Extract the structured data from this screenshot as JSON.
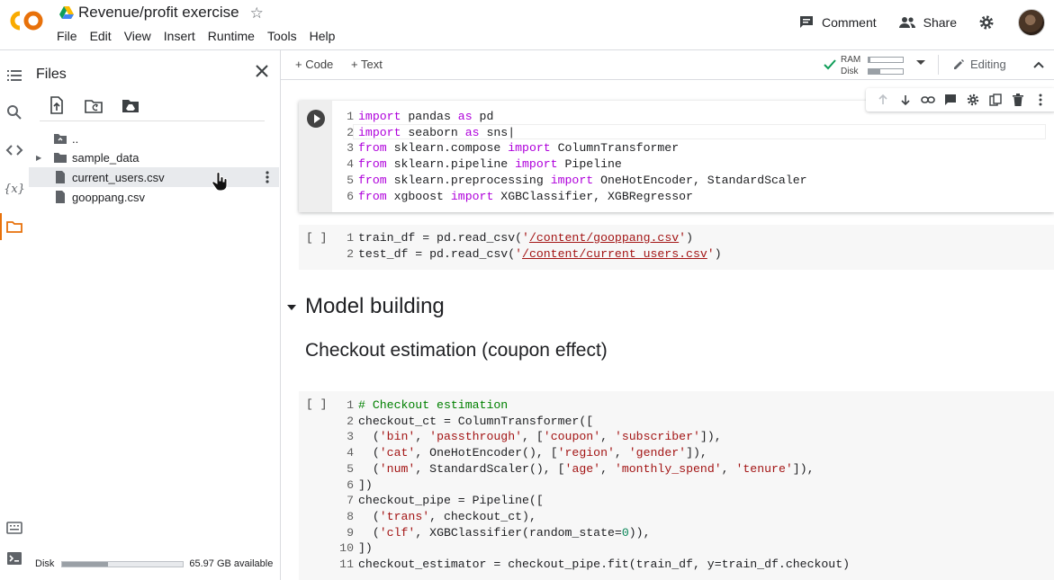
{
  "header": {
    "doc_title": "Revenue/profit exercise",
    "menu": [
      "File",
      "Edit",
      "View",
      "Insert",
      "Runtime",
      "Tools",
      "Help"
    ],
    "comment_label": "Comment",
    "share_label": "Share"
  },
  "files_panel": {
    "title": "Files",
    "items": [
      {
        "label": "..",
        "icon": "folder-up-icon"
      },
      {
        "label": "sample_data",
        "icon": "folder-icon"
      },
      {
        "label": "current_users.csv",
        "icon": "file-icon"
      },
      {
        "label": "gooppang.csv",
        "icon": "file-icon"
      }
    ],
    "disk_label": "Disk",
    "disk_available": "65.97 GB available",
    "disk_used_fraction": 0.38
  },
  "toolbar": {
    "add_code": "+ Code",
    "add_text": "+ Text",
    "ram_label": "RAM",
    "disk_label": "Disk",
    "ram_used_fraction": 0.05,
    "disk_used_fraction": 0.35,
    "editing_label": "Editing"
  },
  "cells": {
    "cell1_exec": "",
    "cell2_exec": "[ ]",
    "cell3_exec": "[ ]",
    "model_building_heading": "Model building",
    "checkout_heading": "Checkout estimation (coupon effect)"
  },
  "colors": {
    "accent": "#e8710a",
    "keyword": "#af00db",
    "string": "#a31515",
    "comment": "#008000",
    "number": "#098658"
  }
}
